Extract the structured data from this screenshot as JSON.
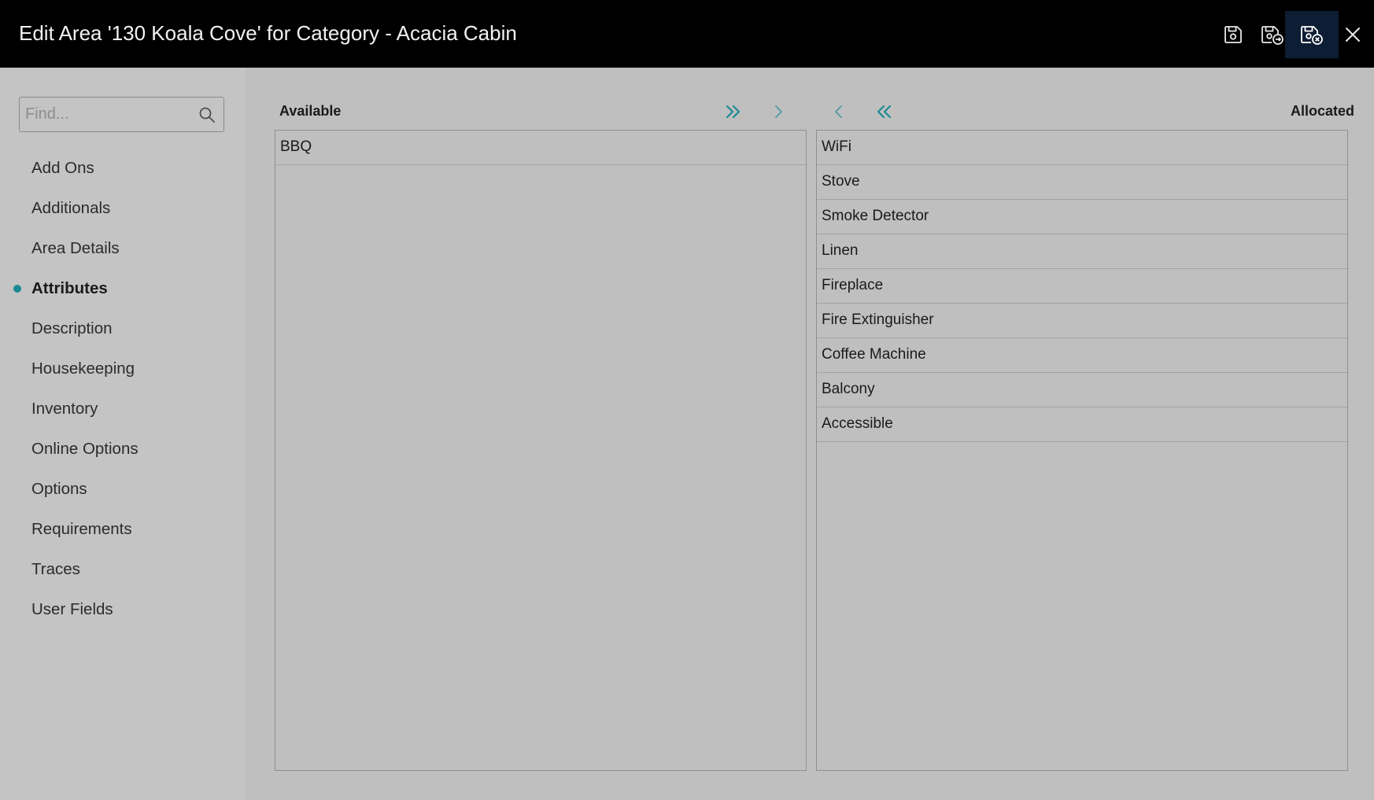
{
  "header": {
    "title": "Edit Area '130 Koala Cove' for Category - Acacia Cabin",
    "buttons": [
      {
        "icon": "save-icon"
      },
      {
        "icon": "save-and-new-icon"
      },
      {
        "icon": "save-and-close-icon"
      },
      {
        "icon": "close-icon"
      }
    ]
  },
  "sidebar": {
    "search": {
      "placeholder": "Find...",
      "value": ""
    },
    "items": [
      {
        "label": "Add Ons",
        "active": false
      },
      {
        "label": "Additionals",
        "active": false
      },
      {
        "label": "Area Details",
        "active": false
      },
      {
        "label": "Attributes",
        "active": true
      },
      {
        "label": "Description",
        "active": false
      },
      {
        "label": "Housekeeping",
        "active": false
      },
      {
        "label": "Inventory",
        "active": false
      },
      {
        "label": "Online Options",
        "active": false
      },
      {
        "label": "Options",
        "active": false
      },
      {
        "label": "Requirements",
        "active": false
      },
      {
        "label": "Traces",
        "active": false
      },
      {
        "label": "User Fields",
        "active": false
      }
    ]
  },
  "main": {
    "available": {
      "label": "Available",
      "items": [
        "BBQ"
      ]
    },
    "allocated": {
      "label": "Allocated",
      "items": [
        "WiFi",
        "Stove",
        "Smoke Detector",
        "Linen",
        "Fireplace",
        "Fire Extinguisher",
        "Coffee Machine",
        "Balcony",
        "Accessible"
      ]
    },
    "transfer_buttons": [
      {
        "icon": "double-chevron-right-icon"
      },
      {
        "icon": "chevron-right-icon"
      },
      {
        "icon": "chevron-left-icon"
      },
      {
        "icon": "double-chevron-left-icon"
      }
    ]
  },
  "colors": {
    "header_bg": "#000000",
    "active_button_bg": "#0d1d33",
    "accent_teal": "#1a8a94",
    "sidebar_bg": "#c4c4c4",
    "main_bg": "#bfbfbf"
  }
}
